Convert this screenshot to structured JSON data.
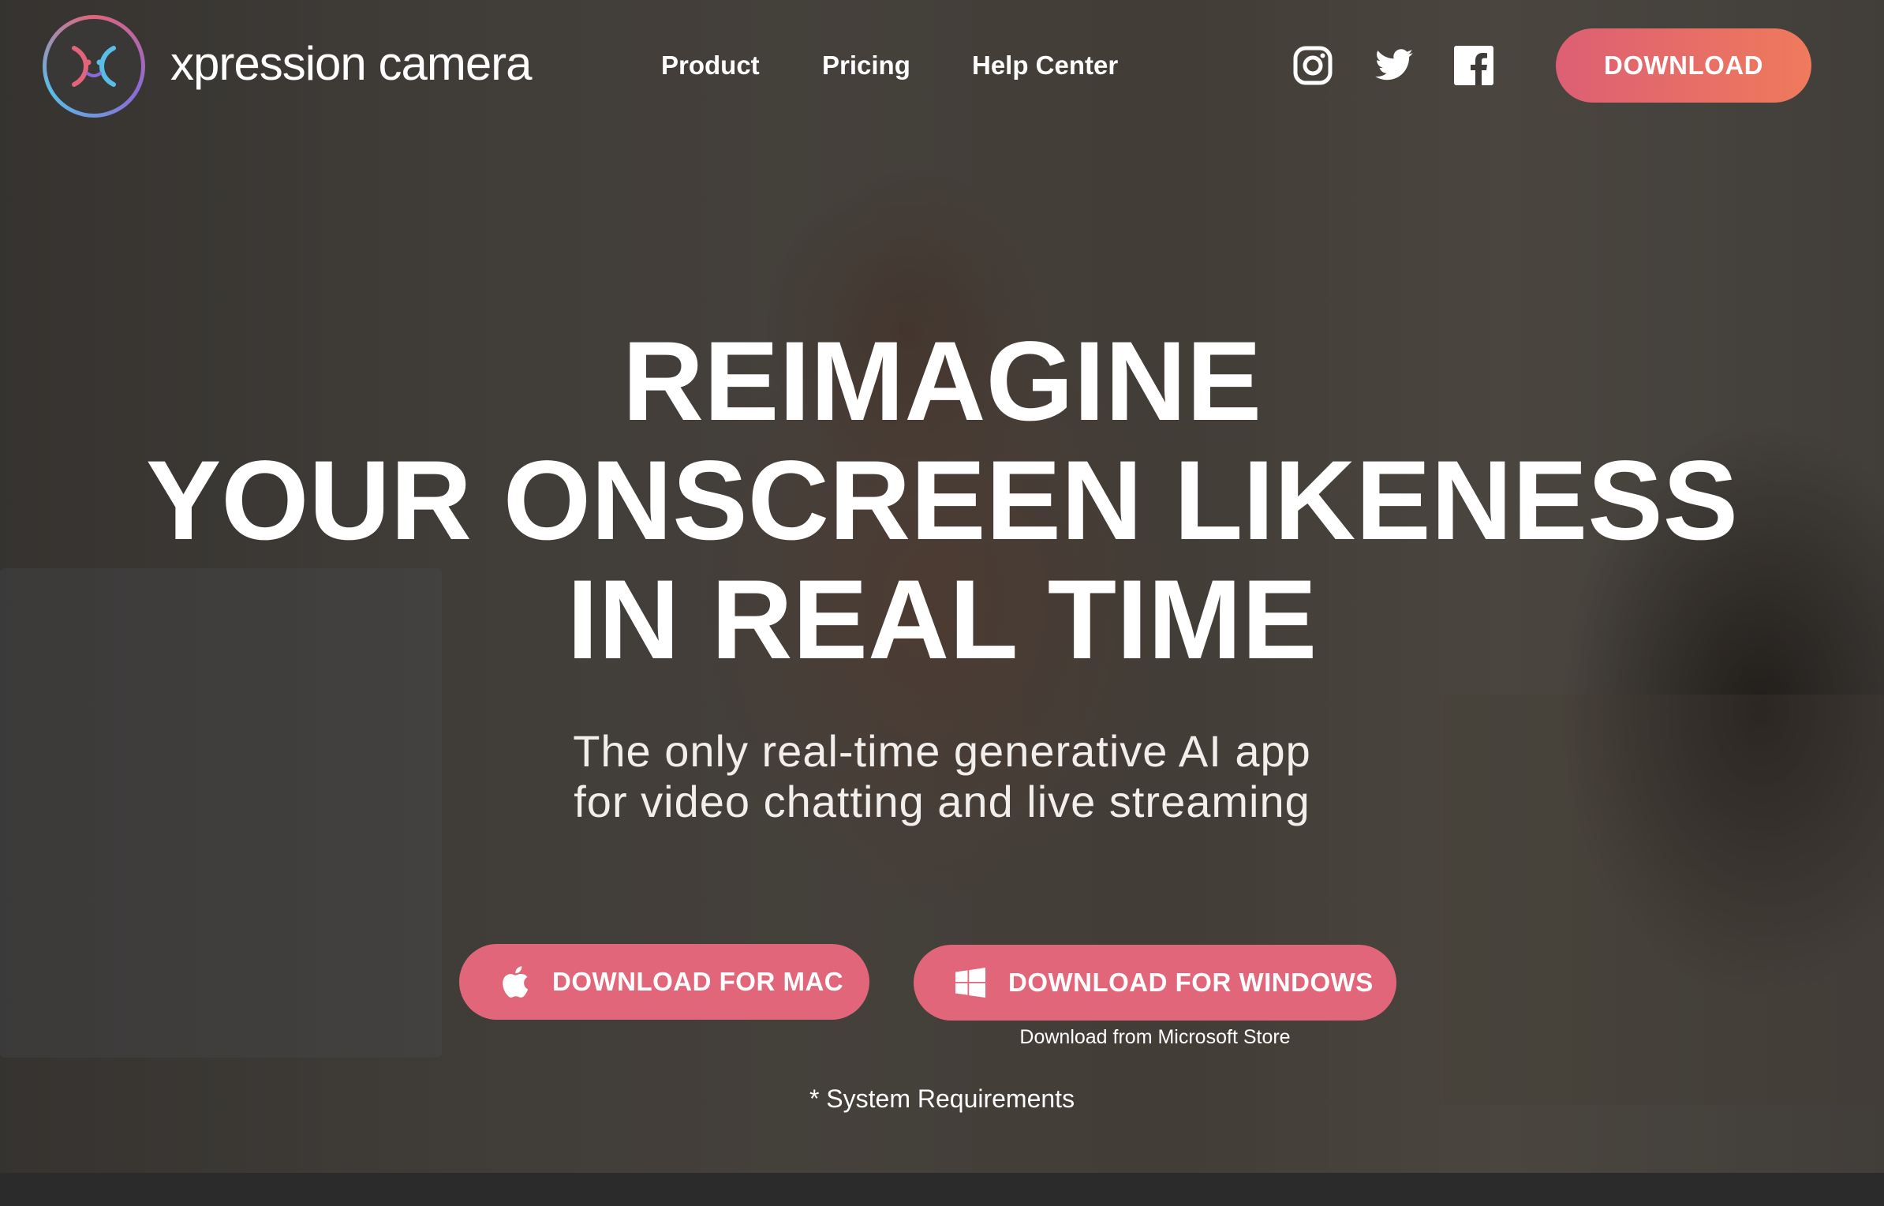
{
  "nav": {
    "brand_bold": "xpression",
    "brand_light": " camera",
    "links": [
      "Product",
      "Pricing",
      "Help Center"
    ],
    "social_icons": [
      "instagram-icon",
      "twitter-icon",
      "facebook-icon"
    ],
    "download_label": "DOWNLOAD"
  },
  "hero": {
    "headline_lines": [
      "REIMAGINE",
      "YOUR ONSCREEN LIKENESS",
      "IN REAL TIME"
    ],
    "subhead_lines": [
      "The only real-time generative AI app",
      "for video chatting and live streaming"
    ],
    "mac_button_label": "DOWNLOAD FOR MAC",
    "windows_button_label": "DOWNLOAD FOR WINDOWS",
    "ms_store_note": "Download from Microsoft Store",
    "system_requirements": "* System Requirements"
  },
  "colors": {
    "accent": "#e2667a",
    "accent_gradient_end": "#ef7a5c"
  }
}
